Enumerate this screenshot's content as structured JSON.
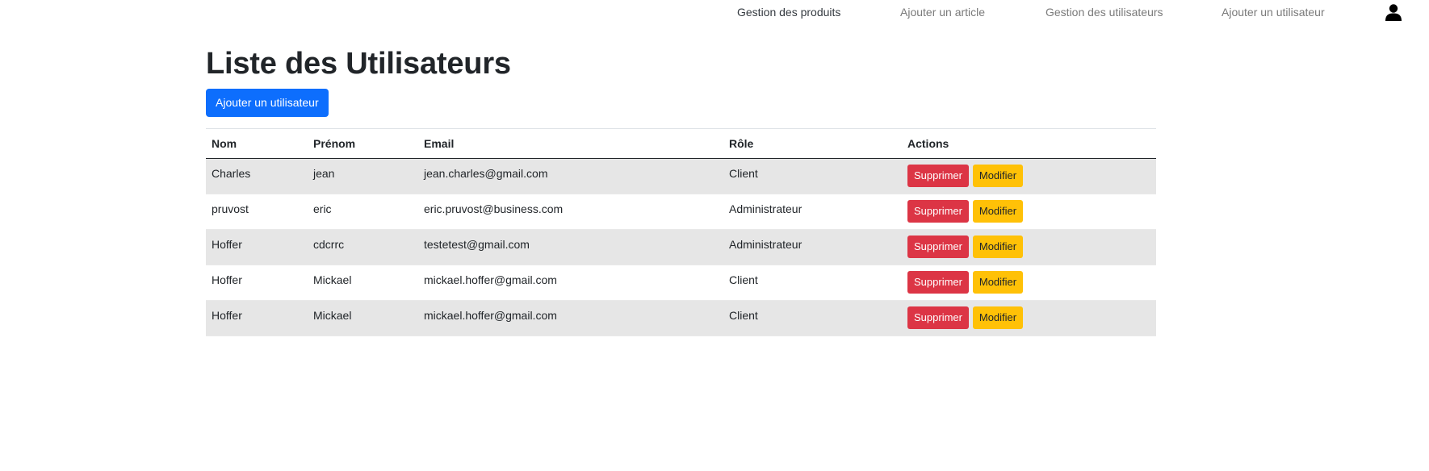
{
  "nav": {
    "items": [
      {
        "label": "Gestion des produits",
        "active": true
      },
      {
        "label": "Ajouter un article",
        "active": false
      },
      {
        "label": "Gestion des utilisateurs",
        "active": false
      },
      {
        "label": "Ajouter un utilisateur",
        "active": false
      }
    ],
    "user_icon": "user-icon"
  },
  "page": {
    "title": "Liste des Utilisateurs",
    "add_button": "Ajouter un utilisateur"
  },
  "table": {
    "headers": [
      "Nom",
      "Prénom",
      "Email",
      "Rôle",
      "Actions"
    ],
    "delete_label": "Supprimer",
    "edit_label": "Modifier",
    "rows": [
      [
        "Charles",
        "jean",
        "jean.charles@gmail.com",
        "Client"
      ],
      [
        "pruvost",
        "eric",
        "eric.pruvost@business.com",
        "Administrateur"
      ],
      [
        "Hoffer",
        "cdcrrc",
        "testetest@gmail.com",
        "Administrateur"
      ],
      [
        "Hoffer",
        "Mickael",
        "mickael.hoffer@gmail.com",
        "Client"
      ],
      [
        "Hoffer",
        "Mickael",
        "mickael.hoffer@gmail.com",
        "Client"
      ]
    ]
  },
  "colors": {
    "primary": "#0d6efd",
    "danger": "#dc3545",
    "warning": "#ffc107",
    "stripe": "#e6e6e6"
  }
}
